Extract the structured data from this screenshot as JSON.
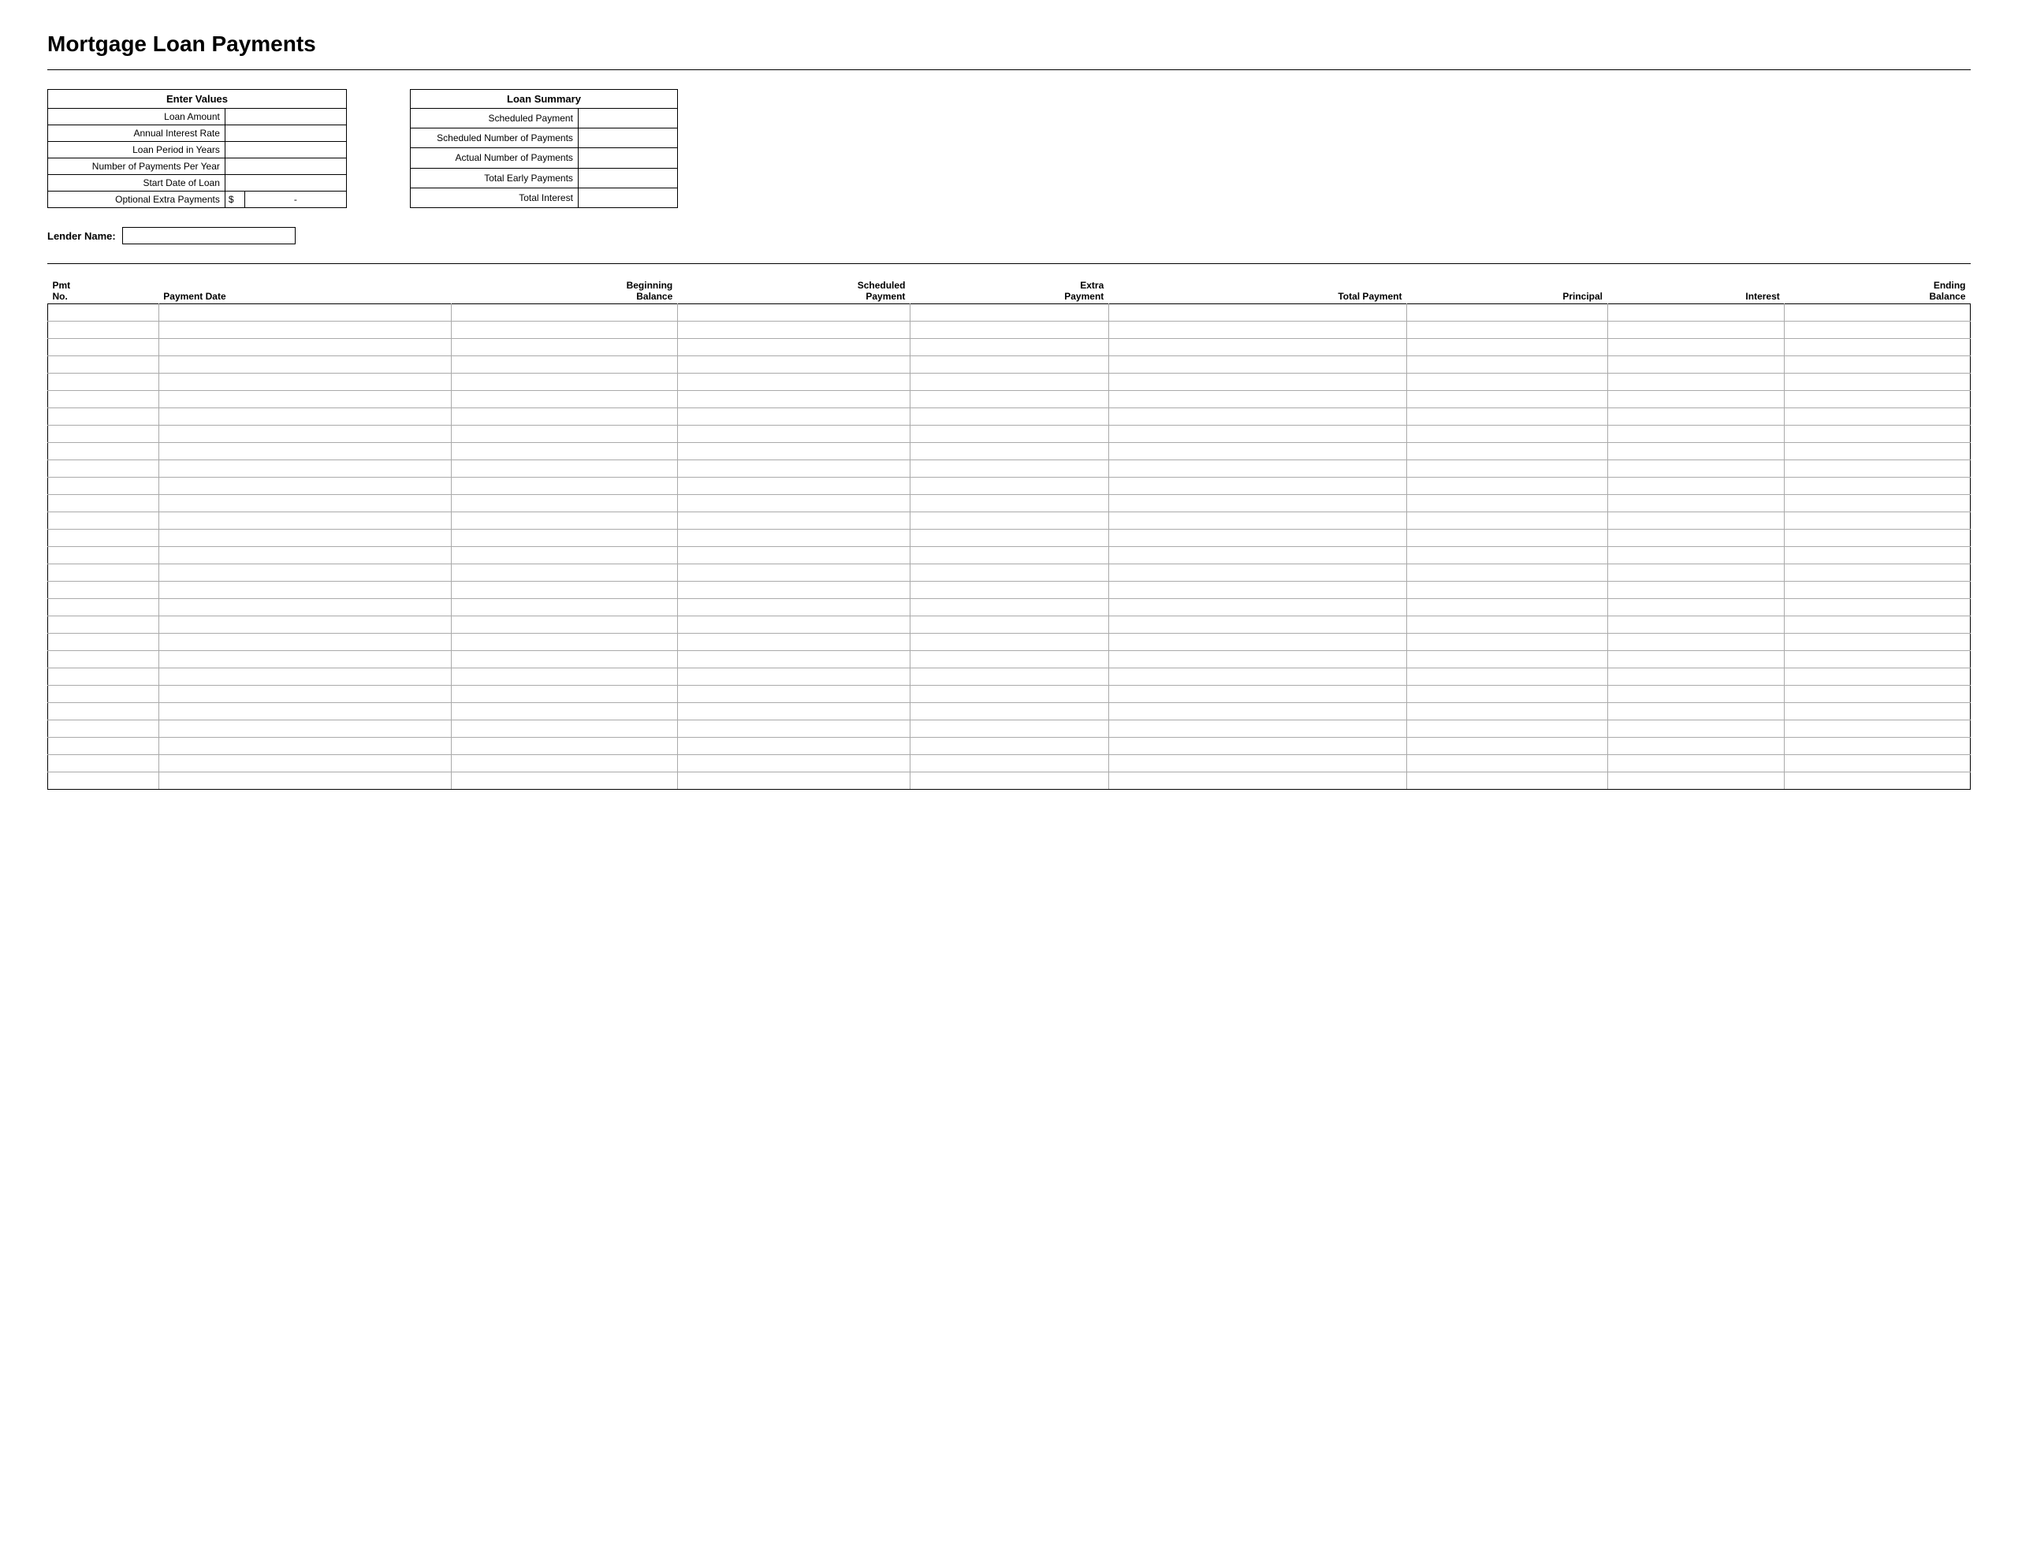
{
  "title": "Mortgage Loan Payments",
  "enterValues": {
    "header": "Enter Values",
    "fields": [
      {
        "label": "Loan Amount",
        "value": ""
      },
      {
        "label": "Annual Interest Rate",
        "value": ""
      },
      {
        "label": "Loan Period in Years",
        "value": ""
      },
      {
        "label": "Number of Payments Per Year",
        "value": ""
      },
      {
        "label": "Start Date of Loan",
        "value": ""
      },
      {
        "label": "Optional Extra Payments",
        "prefix": "$",
        "value": "-"
      }
    ]
  },
  "loanSummary": {
    "header": "Loan Summary",
    "fields": [
      {
        "label": "Scheduled Payment",
        "value": ""
      },
      {
        "label": "Scheduled Number of Payments",
        "value": ""
      },
      {
        "label": "Actual Number of Payments",
        "value": ""
      },
      {
        "label": "Total Early Payments",
        "value": ""
      },
      {
        "label": "Total Interest",
        "value": ""
      }
    ]
  },
  "lenderLabel": "Lender Name:",
  "lenderValue": "",
  "table": {
    "headers": [
      {
        "line1": "Pmt",
        "line2": "No.",
        "align": "left"
      },
      {
        "line1": "",
        "line2": "Payment Date",
        "align": "left"
      },
      {
        "line1": "Beginning",
        "line2": "Balance",
        "align": "right"
      },
      {
        "line1": "Scheduled",
        "line2": "Payment",
        "align": "right"
      },
      {
        "line1": "Extra",
        "line2": "Payment",
        "align": "right"
      },
      {
        "line1": "",
        "line2": "Total Payment",
        "align": "right"
      },
      {
        "line1": "",
        "line2": "Principal",
        "align": "right"
      },
      {
        "line1": "",
        "line2": "Interest",
        "align": "right"
      },
      {
        "line1": "Ending",
        "line2": "Balance",
        "align": "right"
      }
    ],
    "rowCount": 28
  }
}
